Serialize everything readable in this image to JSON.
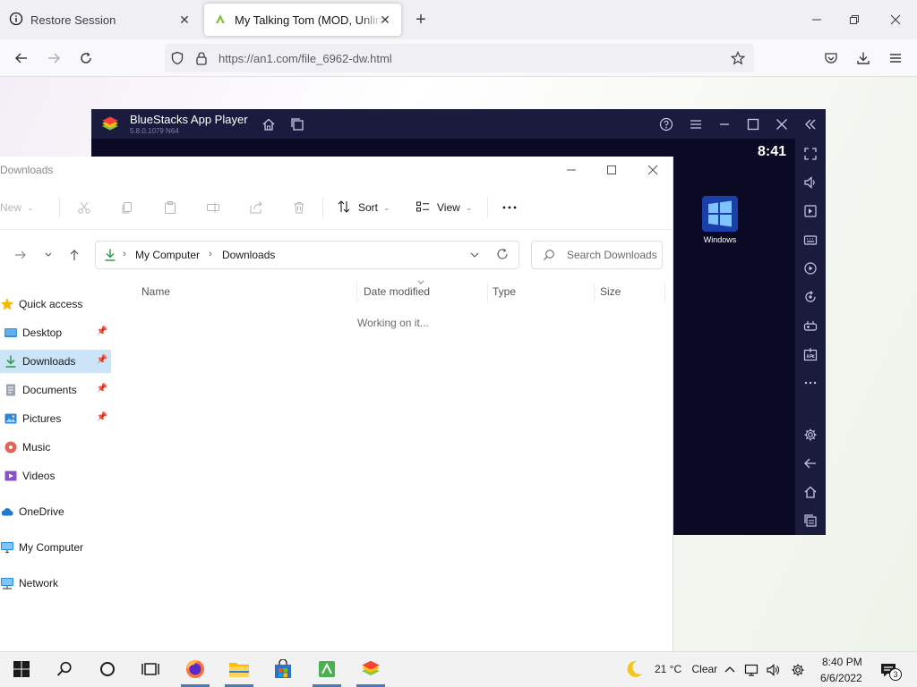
{
  "browser": {
    "tabs": [
      {
        "title": "Restore Session",
        "icon": "info-icon"
      },
      {
        "title": "My Talking Tom (MOD, Unlimited",
        "icon": "an1-favicon"
      }
    ],
    "url": "https://an1.com/file_6962-dw.html"
  },
  "bluestacks": {
    "title": "BlueStacks App Player",
    "version": "5.8.0.1079 N64",
    "clock": "8:41",
    "desktop_icon_label": "Windows"
  },
  "explorer": {
    "title": "Downloads",
    "toolbar": {
      "new": "New",
      "sort": "Sort",
      "view": "View"
    },
    "breadcrumb": [
      "My Computer",
      "Downloads"
    ],
    "search_placeholder": "Search Downloads",
    "nav": {
      "quick_access": "Quick access",
      "desktop": "Desktop",
      "downloads": "Downloads",
      "documents": "Documents",
      "pictures": "Pictures",
      "music": "Music",
      "videos": "Videos",
      "onedrive": "OneDrive",
      "my_computer": "My Computer",
      "network": "Network"
    },
    "columns": {
      "name": "Name",
      "date": "Date modified",
      "type": "Type",
      "size": "Size"
    },
    "status": "Working on it..."
  },
  "taskbar": {
    "temperature": "21 °C",
    "weather": "Clear",
    "time": "8:40 PM",
    "date": "6/6/2022",
    "notification_count": "3"
  },
  "colors": {
    "accent": "#0067c0",
    "bluestacks_bg": "#1b1c3d",
    "selection": "#cce4f7"
  }
}
